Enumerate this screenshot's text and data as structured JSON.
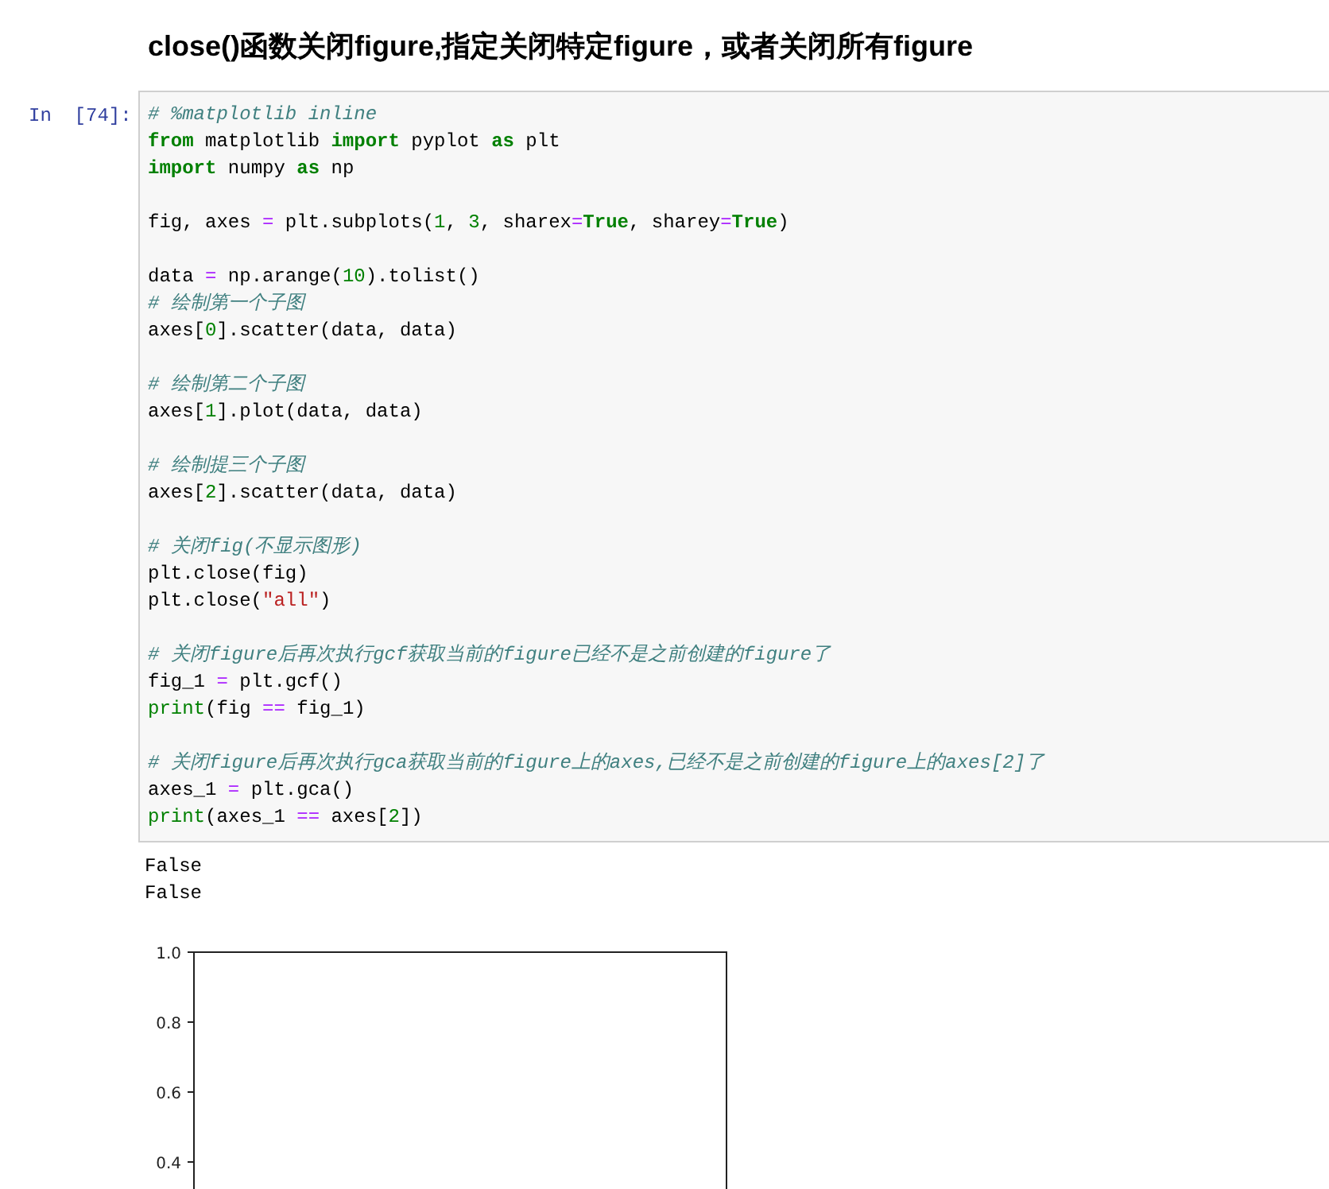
{
  "heading": "close()函数关闭figure,指定关闭特定figure，或者关闭所有figure",
  "cell": {
    "prompt": "In  [74]:",
    "lines": [
      {
        "kind": "code",
        "tokens": [
          {
            "text": "# %matplotlib inline",
            "kind": "comment"
          }
        ]
      },
      {
        "kind": "code",
        "tokens": [
          {
            "text": "from",
            "kind": "keyword"
          },
          {
            "text": " matplotlib ",
            "kind": "plain"
          },
          {
            "text": "import",
            "kind": "keyword"
          },
          {
            "text": " pyplot ",
            "kind": "plain"
          },
          {
            "text": "as",
            "kind": "keyword"
          },
          {
            "text": " plt",
            "kind": "plain"
          }
        ]
      },
      {
        "kind": "code",
        "tokens": [
          {
            "text": "import",
            "kind": "keyword"
          },
          {
            "text": " numpy ",
            "kind": "plain"
          },
          {
            "text": "as",
            "kind": "keyword"
          },
          {
            "text": " np",
            "kind": "plain"
          }
        ]
      },
      {
        "kind": "blank"
      },
      {
        "kind": "code",
        "tokens": [
          {
            "text": "fig, axes ",
            "kind": "plain"
          },
          {
            "text": "=",
            "kind": "operator"
          },
          {
            "text": " plt.subplots(",
            "kind": "plain"
          },
          {
            "text": "1",
            "kind": "number"
          },
          {
            "text": ", ",
            "kind": "plain"
          },
          {
            "text": "3",
            "kind": "number"
          },
          {
            "text": ", sharex",
            "kind": "plain"
          },
          {
            "text": "=",
            "kind": "operator"
          },
          {
            "text": "True",
            "kind": "keyword"
          },
          {
            "text": ", sharey",
            "kind": "plain"
          },
          {
            "text": "=",
            "kind": "operator"
          },
          {
            "text": "True",
            "kind": "keyword"
          },
          {
            "text": ")",
            "kind": "plain"
          }
        ]
      },
      {
        "kind": "blank"
      },
      {
        "kind": "code",
        "tokens": [
          {
            "text": "data ",
            "kind": "plain"
          },
          {
            "text": "=",
            "kind": "operator"
          },
          {
            "text": " np.arange(",
            "kind": "plain"
          },
          {
            "text": "10",
            "kind": "number"
          },
          {
            "text": ").tolist()",
            "kind": "plain"
          }
        ]
      },
      {
        "kind": "code",
        "tokens": [
          {
            "text": "# 绘制第一个子图",
            "kind": "comment"
          }
        ]
      },
      {
        "kind": "code",
        "tokens": [
          {
            "text": "axes[",
            "kind": "plain"
          },
          {
            "text": "0",
            "kind": "number"
          },
          {
            "text": "].scatter(data, data)",
            "kind": "plain"
          }
        ]
      },
      {
        "kind": "blank"
      },
      {
        "kind": "code",
        "tokens": [
          {
            "text": "# 绘制第二个子图",
            "kind": "comment"
          }
        ]
      },
      {
        "kind": "code",
        "tokens": [
          {
            "text": "axes[",
            "kind": "plain"
          },
          {
            "text": "1",
            "kind": "number"
          },
          {
            "text": "].plot(data, data)",
            "kind": "plain"
          }
        ]
      },
      {
        "kind": "blank"
      },
      {
        "kind": "code",
        "tokens": [
          {
            "text": "# 绘制提三个子图",
            "kind": "comment"
          }
        ]
      },
      {
        "kind": "code",
        "tokens": [
          {
            "text": "axes[",
            "kind": "plain"
          },
          {
            "text": "2",
            "kind": "number"
          },
          {
            "text": "].scatter(data, data)",
            "kind": "plain"
          }
        ]
      },
      {
        "kind": "blank"
      },
      {
        "kind": "code",
        "tokens": [
          {
            "text": "# 关闭fig(不显示图形)",
            "kind": "comment"
          }
        ]
      },
      {
        "kind": "code",
        "tokens": [
          {
            "text": "plt.close(fig)",
            "kind": "plain"
          }
        ]
      },
      {
        "kind": "code",
        "tokens": [
          {
            "text": "plt.close(",
            "kind": "plain"
          },
          {
            "text": "\"all\"",
            "kind": "string"
          },
          {
            "text": ")",
            "kind": "plain"
          }
        ]
      },
      {
        "kind": "blank"
      },
      {
        "kind": "code",
        "tokens": [
          {
            "text": "# 关闭figure后再次执行gcf获取当前的figure已经不是之前创建的figure了",
            "kind": "comment"
          }
        ]
      },
      {
        "kind": "code",
        "tokens": [
          {
            "text": "fig_1 ",
            "kind": "plain"
          },
          {
            "text": "=",
            "kind": "operator"
          },
          {
            "text": " plt.gcf()",
            "kind": "plain"
          }
        ]
      },
      {
        "kind": "code",
        "tokens": [
          {
            "text": "print",
            "kind": "builtin"
          },
          {
            "text": "(fig ",
            "kind": "plain"
          },
          {
            "text": "==",
            "kind": "operator"
          },
          {
            "text": " fig_1)",
            "kind": "plain"
          }
        ]
      },
      {
        "kind": "blank"
      },
      {
        "kind": "code",
        "tokens": [
          {
            "text": "# 关闭figure后再次执行gca获取当前的figure上的axes,已经不是之前创建的figure上的axes[2]了",
            "kind": "comment"
          }
        ]
      },
      {
        "kind": "code",
        "tokens": [
          {
            "text": "axes_1 ",
            "kind": "plain"
          },
          {
            "text": "=",
            "kind": "operator"
          },
          {
            "text": " plt.gca()",
            "kind": "plain"
          }
        ]
      },
      {
        "kind": "code",
        "tokens": [
          {
            "text": "print",
            "kind": "builtin"
          },
          {
            "text": "(axes_1 ",
            "kind": "plain"
          },
          {
            "text": "==",
            "kind": "operator"
          },
          {
            "text": " axes[",
            "kind": "plain"
          },
          {
            "text": "2",
            "kind": "number"
          },
          {
            "text": "])",
            "kind": "plain"
          }
        ]
      }
    ]
  },
  "output": {
    "lines": [
      "False",
      "False"
    ],
    "empty_plot": {
      "ytick_labels": [
        "1.0",
        "0.8",
        "0.6",
        "0.4"
      ]
    }
  }
}
